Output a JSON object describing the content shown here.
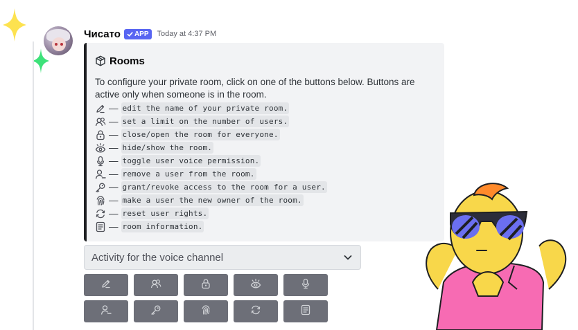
{
  "message": {
    "username": "Чисато",
    "badge": "APP",
    "timestamp": "Today at 4:37 PM"
  },
  "embed": {
    "title": "Rooms",
    "description": "To configure your private room, click on one of the buttons below. Buttons are active only when someone is in the room.",
    "dash": "—",
    "items": [
      {
        "icon": "pencil-icon",
        "text": "edit the name of your private room."
      },
      {
        "icon": "users-icon",
        "text": "set a limit on the number of users."
      },
      {
        "icon": "lock-icon",
        "text": "close/open the room for everyone."
      },
      {
        "icon": "eye-icon",
        "text": "hide/show the room."
      },
      {
        "icon": "microphone-icon",
        "text": "toggle user voice permission."
      },
      {
        "icon": "user-remove-icon",
        "text": "remove a user from the room."
      },
      {
        "icon": "key-icon",
        "text": "grant/revoke access to the room for a user."
      },
      {
        "icon": "fingerprint-icon",
        "text": "make a user the new owner of the room."
      },
      {
        "icon": "refresh-icon",
        "text": "reset user rights."
      },
      {
        "icon": "document-icon",
        "text": "room information."
      }
    ]
  },
  "select": {
    "placeholder": "Activity for the voice channel"
  },
  "buttons": [
    {
      "icon": "pencil-icon"
    },
    {
      "icon": "users-icon"
    },
    {
      "icon": "lock-icon"
    },
    {
      "icon": "eye-icon"
    },
    {
      "icon": "microphone-icon"
    },
    {
      "icon": "user-remove-icon"
    },
    {
      "icon": "key-icon"
    },
    {
      "icon": "fingerprint-icon"
    },
    {
      "icon": "refresh-icon"
    },
    {
      "icon": "document-icon"
    }
  ],
  "colors": {
    "badge": "#5865f2",
    "button": "#6d6f78",
    "embed_bg": "#f2f3f5",
    "embed_border": "#1e1f22"
  }
}
